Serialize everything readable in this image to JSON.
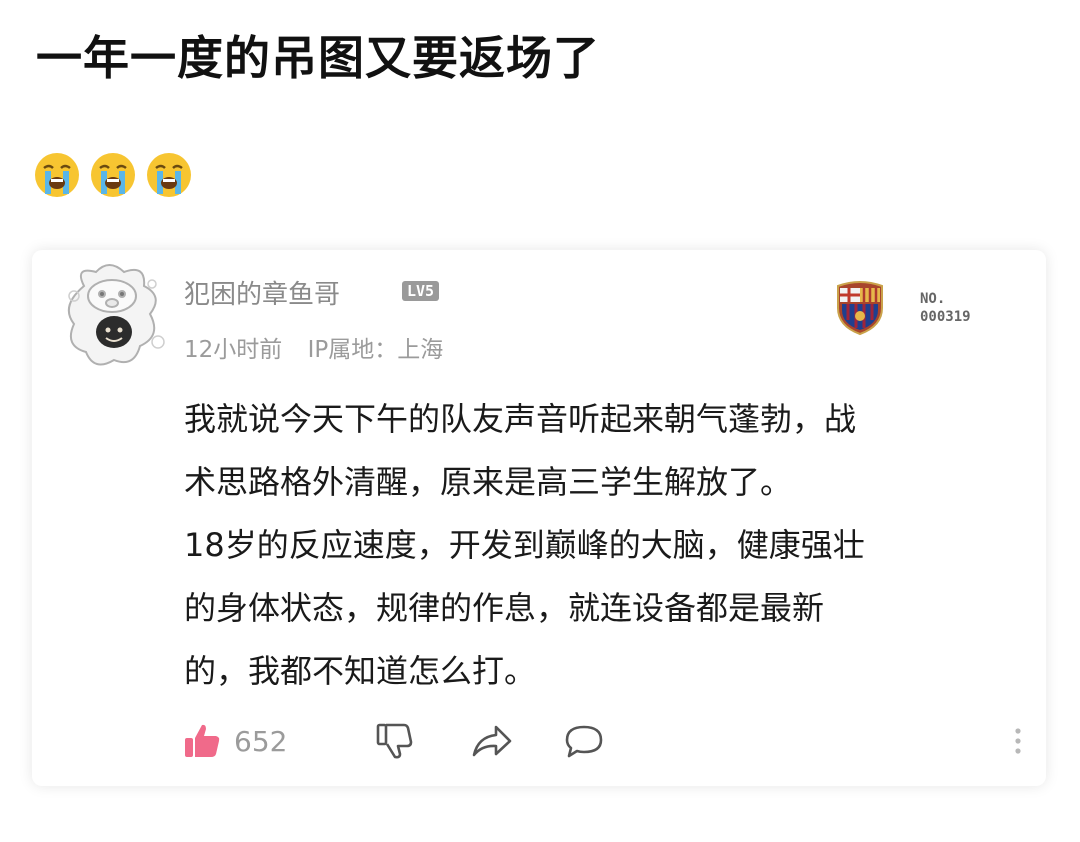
{
  "post": {
    "title": "一年一度的吊图又要返场了",
    "emojis": [
      "crying-face-emoji",
      "crying-face-emoji",
      "crying-face-emoji"
    ]
  },
  "comment_card": {
    "username": "犯困的章鱼哥",
    "level_badge": "LV5",
    "time": "12小时前",
    "ip_location": "IP属地：上海",
    "badge_number": "NO.\n000319",
    "badge_no_prefix": "NO.",
    "badge_no_value": "000319",
    "text_lines": [
      "我就说今天下午的队友声音听起来朝气蓬勃，战",
      "术思路格外清醒，原来是高三学生解放了。",
      "18岁的反应速度，开发到巅峰的大脑，健康强壮",
      "的身体状态，规律的作息，就连设备都是最新",
      "的，我都不知道怎么打。"
    ],
    "likes": "652",
    "icons": {
      "like": "thumbs-up-icon",
      "dislike": "thumbs-down-icon",
      "share": "share-icon",
      "reply": "comment-icon",
      "more": "more-vertical-icon"
    },
    "colors": {
      "like_active": "#f06a8a",
      "muted": "#9b9b9b"
    }
  }
}
